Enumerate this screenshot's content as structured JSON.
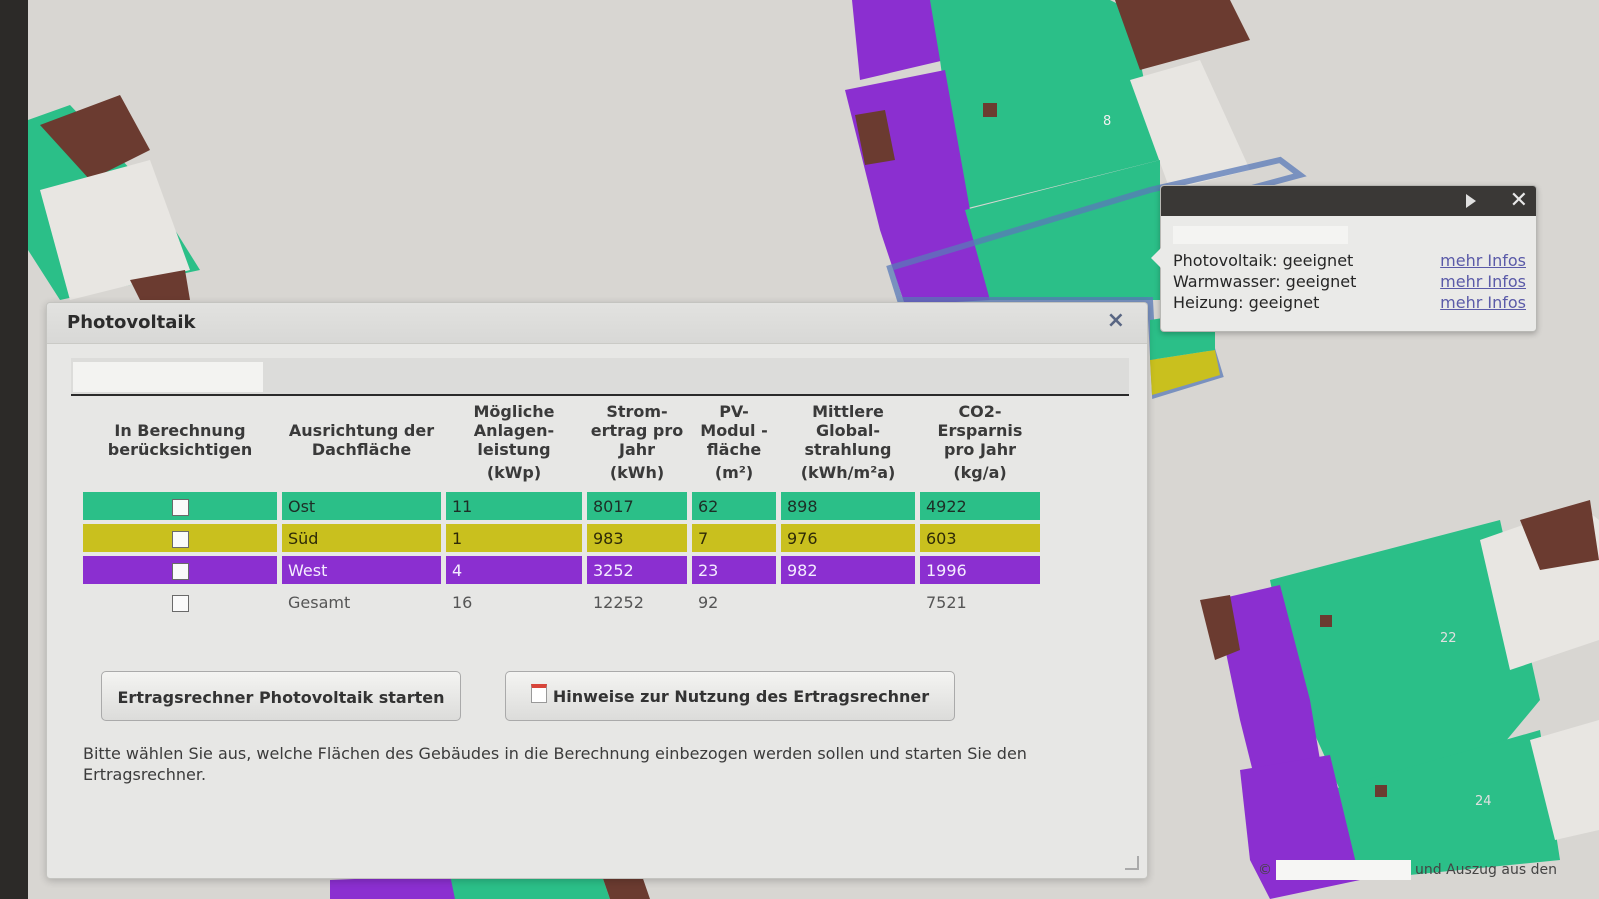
{
  "colors": {
    "green": "#2bbf88",
    "yellow": "#c9c01e",
    "purple": "#8b2fd0",
    "brown": "#6b3b30",
    "map_bg": "#d8d6d2"
  },
  "popup": {
    "rows": [
      {
        "label": "Photovoltaik: geeignet",
        "link": "mehr Infos"
      },
      {
        "label": "Warmwasser: geeignet",
        "link": "mehr Infos"
      },
      {
        "label": "Heizung: geeignet",
        "link": "mehr Infos"
      }
    ],
    "close_glyph": "✕"
  },
  "dialog": {
    "title": "Photovoltaik",
    "close_glyph": "×",
    "table": {
      "headers": [
        "In Berechnung berücksichtigen",
        "Ausrichtung der Dachfläche",
        "Mögliche Anlagen-leistung",
        "Strom-ertrag pro Jahr",
        "PV-Modul - fläche",
        "Mittlere Global-strahlung",
        "CO2-Ersparnis pro Jahr"
      ],
      "units": [
        "",
        "",
        "(kWp)",
        "(kWh)",
        "(m²)",
        "(kWh/m²a)",
        "(kg/a)"
      ],
      "rows": [
        {
          "name": "Ost",
          "leistung": "11",
          "ertrag": "8017",
          "flaeche": "62",
          "strahlung": "898",
          "co2": "4922",
          "color": "#2bbf88",
          "text_color": "#1d2e26"
        },
        {
          "name": "Süd",
          "leistung": "1",
          "ertrag": "983",
          "flaeche": "7",
          "strahlung": "976",
          "co2": "603",
          "color": "#c9c01e",
          "text_color": "#2e2a08"
        },
        {
          "name": "West",
          "leistung": "4",
          "ertrag": "3252",
          "flaeche": "23",
          "strahlung": "982",
          "co2": "1996",
          "color": "#8b2fd0",
          "text_color": "#f4ecff"
        }
      ],
      "total": {
        "name": "Gesamt",
        "leistung": "16",
        "ertrag": "12252",
        "flaeche": "92",
        "strahlung": "",
        "co2": "7521"
      }
    },
    "buttons": {
      "start": "Ertragsrechner Photovoltaik starten",
      "hint": "Hinweise zur Nutzung des Ertragsrechner"
    },
    "hint_text": "Bitte wählen Sie aus, welche Flächen des Gebäudes in die Berechnung einbezogen werden sollen und starten Sie den Ertragsrechner."
  },
  "attribution": {
    "prefix": "©",
    "suffix": "und Auszug aus den"
  },
  "map": {
    "labels": [
      "8",
      "22",
      "24"
    ]
  }
}
